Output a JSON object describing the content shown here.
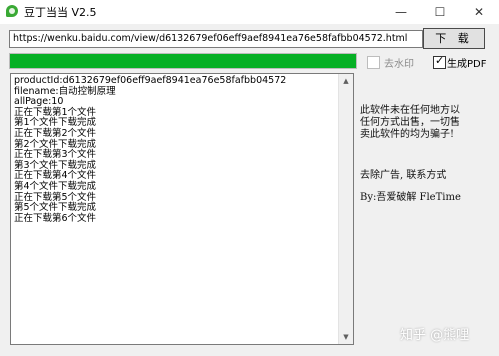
{
  "window": {
    "title": "豆丁当当  V2.5",
    "minimize": "—",
    "maximize": "☐",
    "close": "✕"
  },
  "toolbar": {
    "url_value": "https://wenku.baidu.com/view/d6132679ef06eff9aef8941ea76e58fafbb04572.html",
    "download_label": "下 载"
  },
  "progress": {
    "fraction": 1.0,
    "color": "#06b025"
  },
  "options": {
    "remove_watermark_label": "去水印",
    "remove_watermark_checked": false,
    "generate_pdf_label": "生成PDF",
    "generate_pdf_checked": true
  },
  "log": {
    "lines": [
      "productId:d6132679ef06eff9aef8941ea76e58fafbb04572",
      "filename:自动控制原理",
      "allPage:10",
      "正在下载第1个文件",
      "第1个文件下载完成",
      "正在下载第2个文件",
      "第2个文件下载完成",
      "正在下载第3个文件",
      "第3个文件下载完成",
      "正在下载第4个文件",
      "第4个文件下载完成",
      "正在下载第5个文件",
      "第5个文件下载完成",
      "正在下载第6个文件"
    ]
  },
  "side_notice": {
    "line1": "此软件未在任何地方以",
    "line2": "任何方式出售，一切售",
    "line3": "卖此软件的均为骗子!",
    "ad_line": "去除广告, 联系方式",
    "by_line": "By:吾爱破解 FleTime"
  },
  "watermark": "知乎 @熊哩"
}
